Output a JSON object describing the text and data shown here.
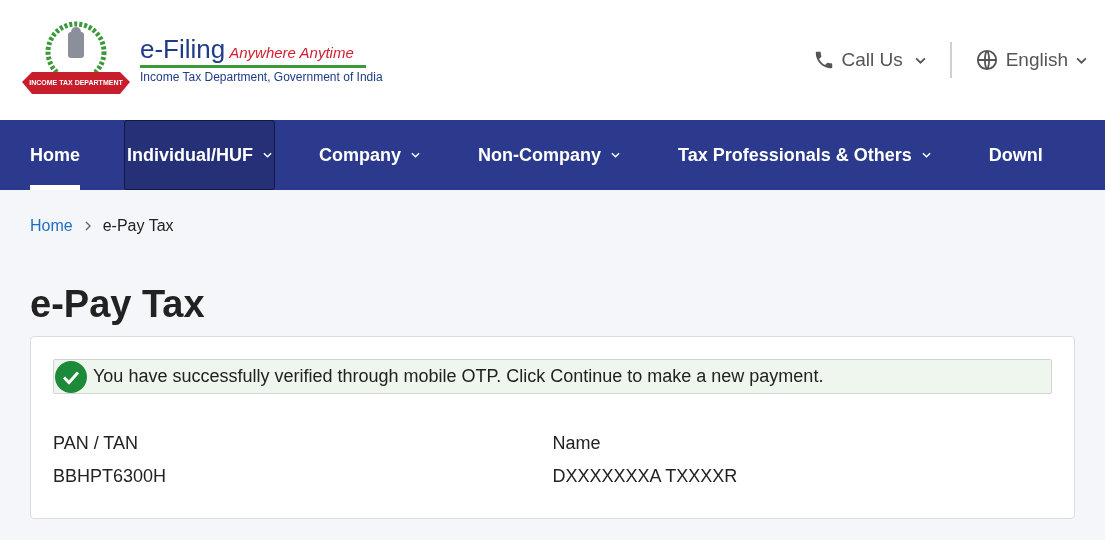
{
  "header": {
    "logo": {
      "ribbon": "INCOME TAX DEPARTMENT",
      "title": "e-Filing",
      "tagline": "Anywhere Anytime",
      "subtitle": "Income Tax Department, Government of India"
    },
    "call_us": {
      "label": "Call Us"
    },
    "language": {
      "label": "English"
    }
  },
  "nav": [
    {
      "label": "Home",
      "selected": true,
      "highlighted": false,
      "dropdown": false
    },
    {
      "label": "Individual/HUF",
      "selected": false,
      "highlighted": true,
      "dropdown": true
    },
    {
      "label": "Company",
      "selected": false,
      "highlighted": false,
      "dropdown": true
    },
    {
      "label": "Non-Company",
      "selected": false,
      "highlighted": false,
      "dropdown": true
    },
    {
      "label": "Tax Professionals & Others",
      "selected": false,
      "highlighted": false,
      "dropdown": true
    },
    {
      "label": "Downl",
      "selected": false,
      "highlighted": false,
      "dropdown": false
    }
  ],
  "breadcrumb": [
    {
      "label": "Home",
      "link": true
    },
    {
      "label": "e-Pay Tax",
      "link": false
    }
  ],
  "page_title": "e-Pay Tax",
  "success_message": "You have successfully verified through mobile OTP. Click Continue to make a new payment.",
  "fields": [
    {
      "label": "PAN / TAN",
      "value": "BBHPT6300H"
    },
    {
      "label": "Name",
      "value": "DXXXXXXXA TXXXXR"
    }
  ]
}
